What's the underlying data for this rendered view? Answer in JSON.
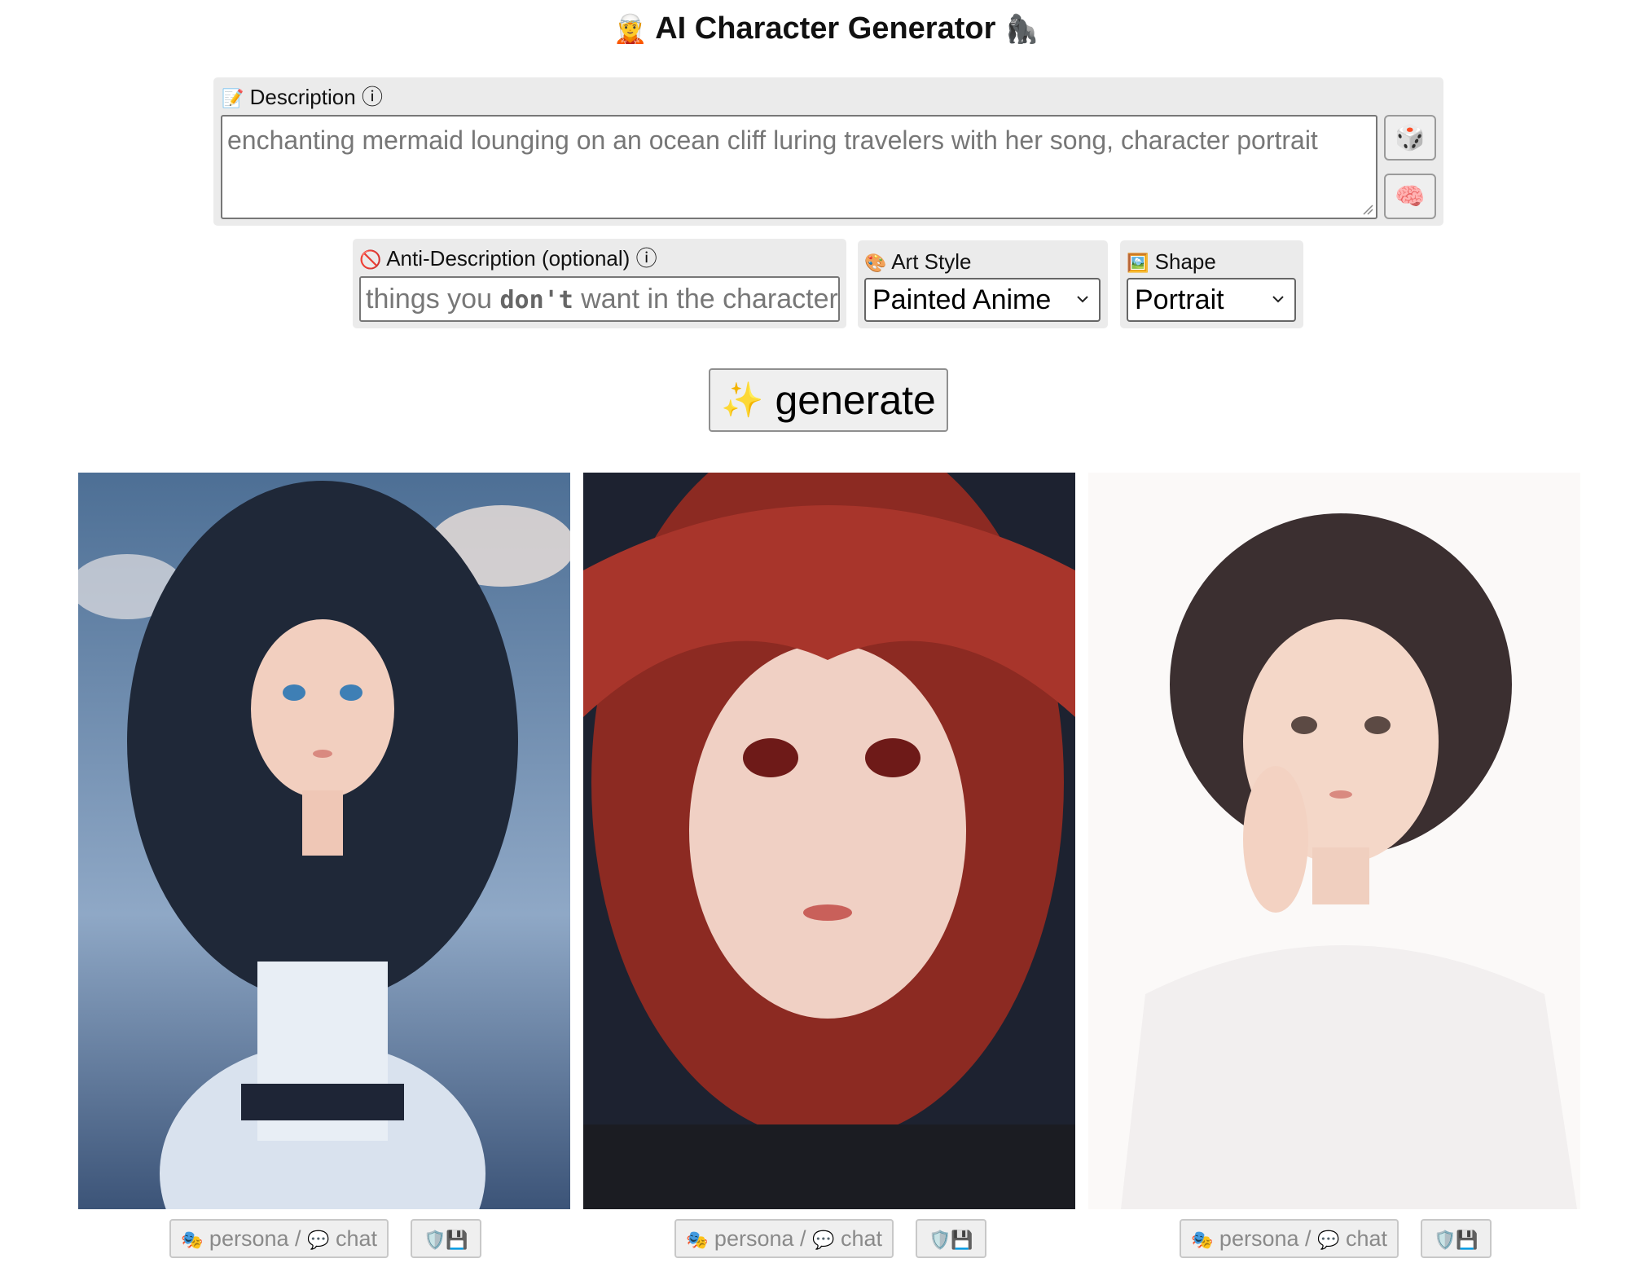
{
  "app": {
    "title": "AI Character Generator",
    "title_left_emoji": "🧝",
    "title_right_emoji": "🦍"
  },
  "description": {
    "icon": "📝",
    "label": "Description",
    "info": "ⓘ",
    "placeholder": "enchanting mermaid lounging on an ocean cliff luring travelers with her song, character portrait",
    "random_button_icon": "🎲",
    "brain_button_icon": "🧠"
  },
  "anti_description": {
    "icon": "🚫",
    "label": "Anti-Description (optional)",
    "info": "ⓘ",
    "placeholder_before": "things you ",
    "placeholder_bold": "don't",
    "placeholder_after": " want in the character"
  },
  "art_style": {
    "icon": "🎨",
    "label": "Art Style",
    "value": "Painted Anime"
  },
  "shape": {
    "icon": "🖼️",
    "label": "Shape",
    "value": "Portrait"
  },
  "generate_button": {
    "icon": "✨",
    "label": "generate"
  },
  "results": [
    {
      "persona_icon": "🎭",
      "persona_label": "persona",
      "separator": "/",
      "chat_icon": "💬",
      "chat_label": "chat",
      "save_icons": "🛡️💾"
    },
    {
      "persona_icon": "🎭",
      "persona_label": "persona",
      "separator": "/",
      "chat_icon": "💬",
      "chat_label": "chat",
      "save_icons": "🛡️💾"
    },
    {
      "persona_icon": "🎭",
      "persona_label": "persona",
      "separator": "/",
      "chat_icon": "💬",
      "chat_label": "chat",
      "save_icons": "🛡️💾"
    }
  ]
}
